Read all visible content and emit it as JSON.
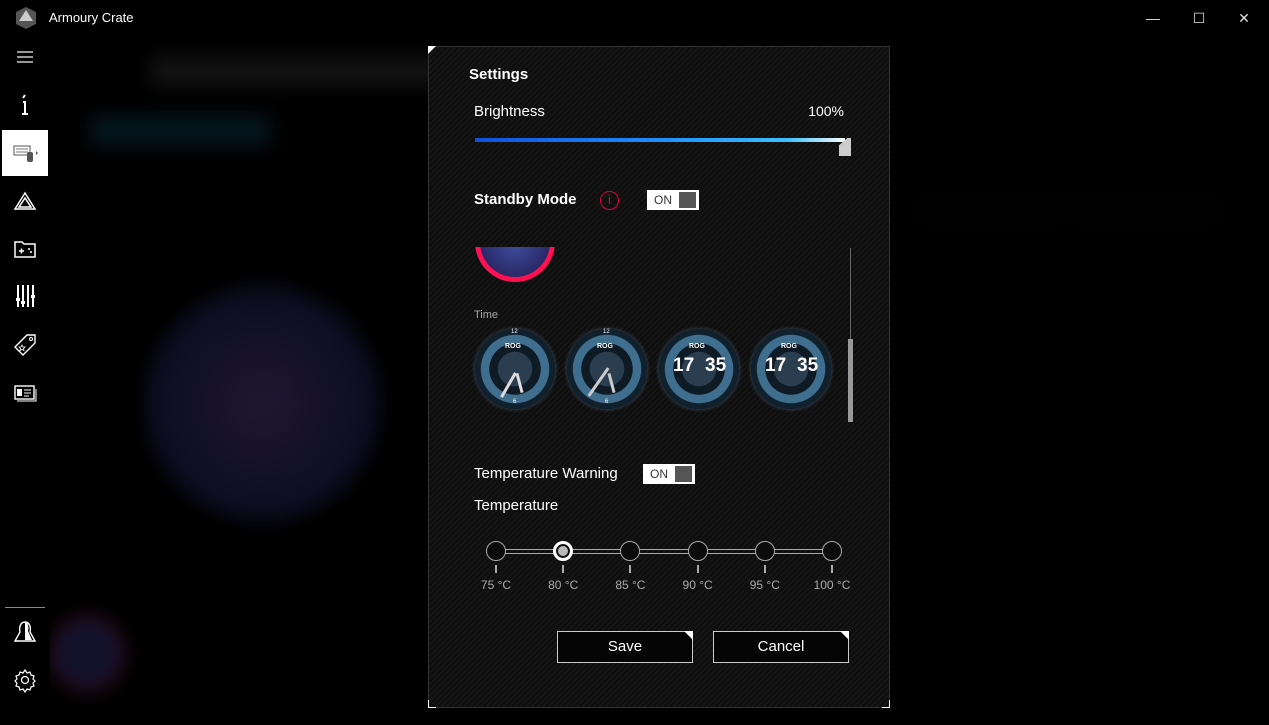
{
  "window": {
    "title": "Armoury Crate",
    "controls": [
      "minimize",
      "maximize",
      "close"
    ]
  },
  "sidebar": {
    "items": [
      {
        "icon": "menu-icon"
      },
      {
        "icon": "info-icon"
      },
      {
        "icon": "devices-icon",
        "selected": true
      },
      {
        "icon": "aura-sync-icon"
      },
      {
        "icon": "game-library-icon"
      },
      {
        "icon": "scenario-profiles-icon"
      },
      {
        "icon": "deals-icon"
      },
      {
        "icon": "news-icon"
      },
      {
        "icon": "user-center-icon"
      },
      {
        "icon": "settings-icon"
      }
    ]
  },
  "dialog": {
    "title": "Settings",
    "brightness": {
      "label": "Brightness",
      "value_text": "100%",
      "value": 100
    },
    "standby": {
      "label": "Standby Mode",
      "toggle": "ON",
      "on": true
    },
    "time": {
      "label": "Time",
      "clocks": [
        {
          "type": "analog",
          "numerals": [
            "12",
            "6"
          ],
          "badge": "ROG"
        },
        {
          "type": "analog",
          "numerals": [
            "12",
            "6"
          ],
          "badge": "ROG"
        },
        {
          "type": "digital",
          "hour": "17",
          "minute": "35",
          "badge": "ROG"
        },
        {
          "type": "digital",
          "hour": "17",
          "minute": "35",
          "badge": "ROG"
        }
      ]
    },
    "temp_warning": {
      "label": "Temperature Warning",
      "toggle": "ON",
      "on": true
    },
    "temperature": {
      "label": "Temperature",
      "options": [
        "75 °C",
        "80 °C",
        "85 °C",
        "90 °C",
        "95 °C",
        "100 °C"
      ],
      "selected": "80 °C"
    },
    "save": "Save",
    "cancel": "Cancel"
  },
  "colors": {
    "accent_blue": "#1e6fff",
    "info_red": "#e0003c"
  }
}
